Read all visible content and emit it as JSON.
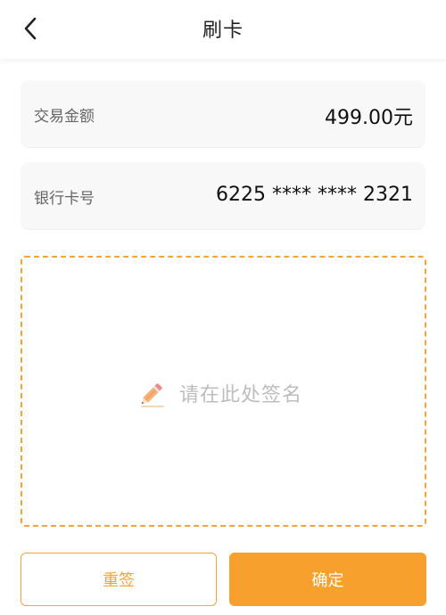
{
  "header": {
    "title": "刷卡",
    "back_icon": "chevron-left-icon"
  },
  "transaction": {
    "amount_label": "交易金额",
    "amount_value": "499.00元",
    "card_label": "银行卡号",
    "card_value": "6225 **** **** 2321"
  },
  "signature": {
    "hint": "请在此处签名",
    "icon": "pencil-icon",
    "border_color": "#f5a33a"
  },
  "actions": {
    "reset_label": "重签",
    "confirm_label": "确定",
    "accent_color": "#f7a02e"
  }
}
